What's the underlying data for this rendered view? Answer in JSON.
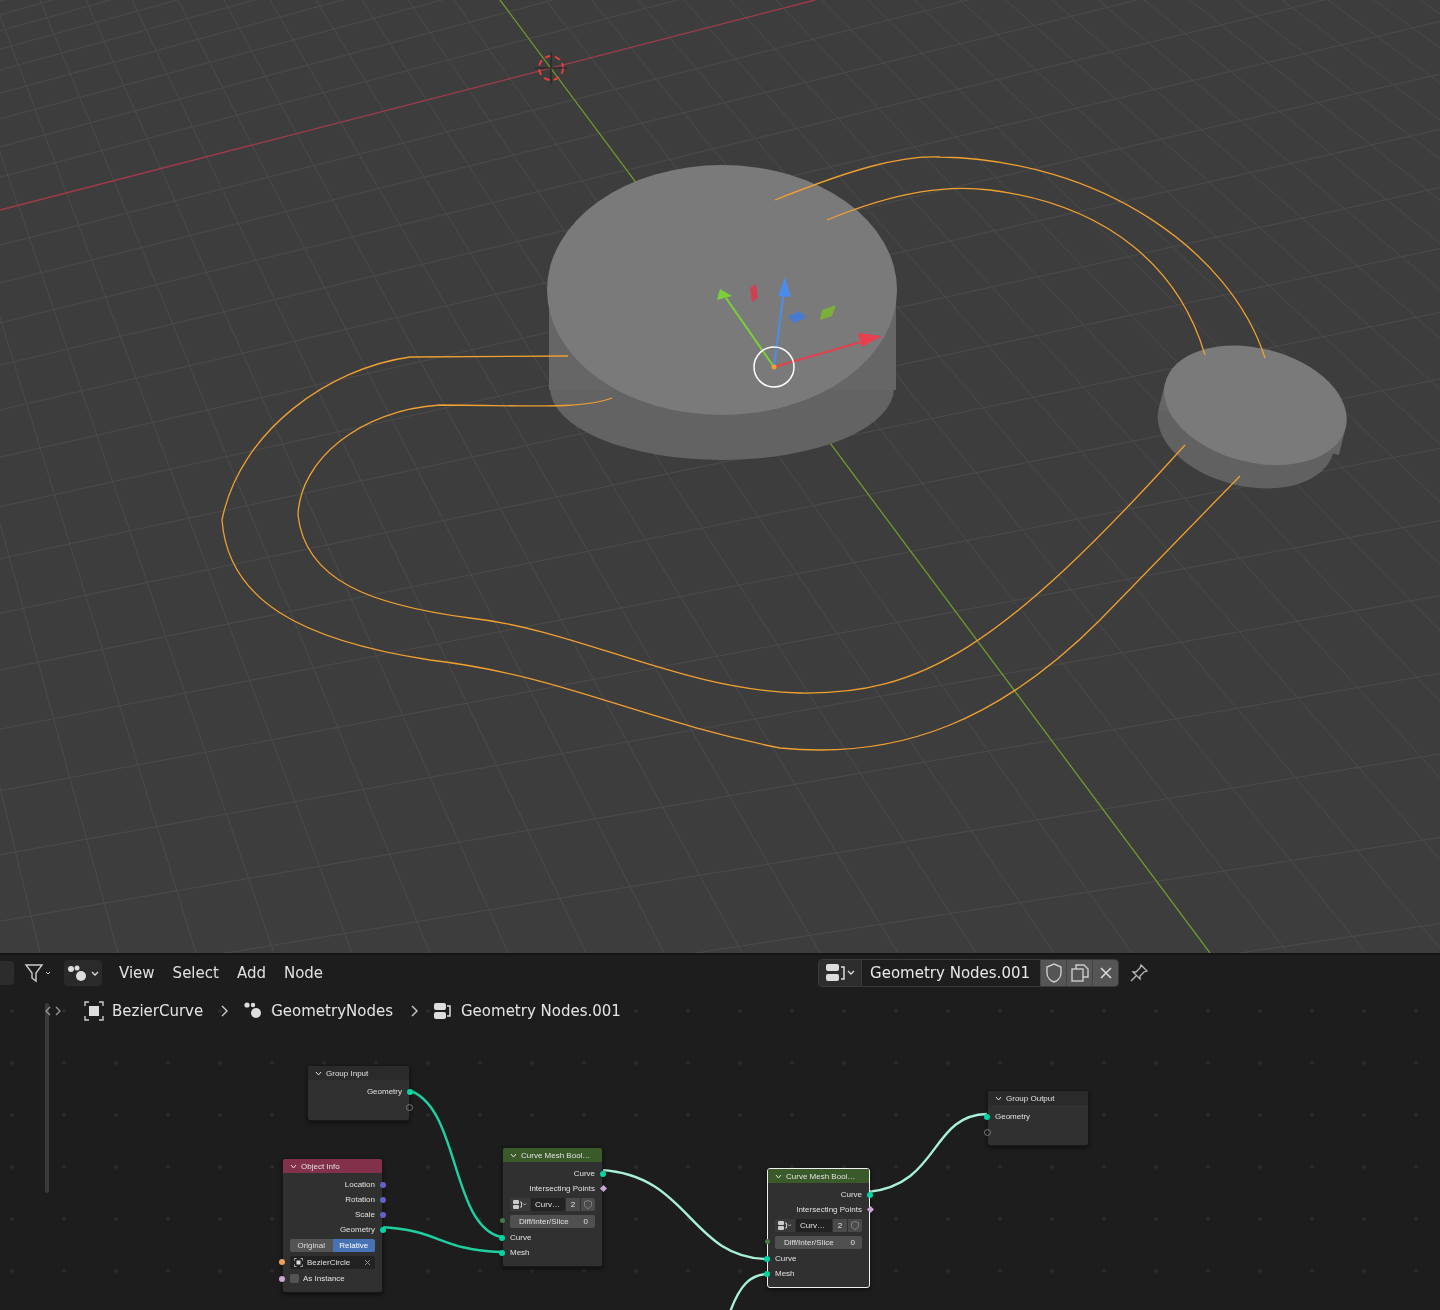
{
  "header": {
    "menus": [
      {
        "label": "View"
      },
      {
        "label": "Select"
      },
      {
        "label": "Add"
      },
      {
        "label": "Node"
      }
    ],
    "node_tree": {
      "name": "Geometry Nodes.001",
      "fake_user": false
    }
  },
  "breadcrumbs": [
    {
      "label": "BezierCurve",
      "kind": "object"
    },
    {
      "label": "GeometryNodes",
      "kind": "modifier"
    },
    {
      "label": "Geometry Nodes.001",
      "kind": "nodetree"
    }
  ],
  "nodes": [
    {
      "title": "Group Input",
      "color": "#2a2a2a",
      "selected": false,
      "rows": [
        {
          "kind": "output",
          "label": "Geometry",
          "color": "#00d6a3"
        },
        {
          "kind": "virtual_output"
        }
      ]
    },
    {
      "title": "Object Info",
      "color": "#83314a",
      "selected": false,
      "rows": [
        {
          "kind": "output",
          "label": "Location",
          "color": "#6363c7"
        },
        {
          "kind": "output",
          "label": "Rotation",
          "color": "#6363c7"
        },
        {
          "kind": "output",
          "label": "Scale",
          "color": "#6363c7"
        },
        {
          "kind": "output",
          "label": "Geometry",
          "color": "#00d6a3"
        },
        {
          "kind": "toggle",
          "options": [
            {
              "label": "Original",
              "selected": false
            },
            {
              "label": "Relative",
              "selected": true
            }
          ]
        },
        {
          "kind": "object_field",
          "value": "BezierCircle",
          "color": "#ed9e5c"
        },
        {
          "kind": "checkbox",
          "label": "As Instance",
          "checked": false,
          "color": "#cca6d6"
        }
      ]
    },
    {
      "title": "Curve Mesh Bool…",
      "color": "#3b5a2a",
      "selected": false,
      "rows": [
        {
          "kind": "output",
          "label": "Curve",
          "color": "#00d6a3"
        },
        {
          "kind": "field_output",
          "label": "Intersecting Points",
          "color": "#cca6d6"
        },
        {
          "kind": "datablock",
          "name": "Curv…",
          "users": "2"
        },
        {
          "kind": "enum",
          "label": "Diff/Inter/Slice",
          "value": "0",
          "color": "#4a7a4a"
        },
        {
          "kind": "input",
          "label": "Curve",
          "color": "#00d6a3"
        },
        {
          "kind": "input",
          "label": "Mesh",
          "color": "#00d6a3"
        }
      ]
    },
    {
      "title": "Curve Mesh Bool…",
      "color": "#3b5a2a",
      "selected": true,
      "rows": [
        {
          "kind": "output",
          "label": "Curve",
          "color": "#00d6a3"
        },
        {
          "kind": "field_output",
          "label": "Intersecting Points",
          "color": "#cca6d6"
        },
        {
          "kind": "datablock",
          "name": "Curv…",
          "users": "2"
        },
        {
          "kind": "enum",
          "label": "Diff/Inter/Slice",
          "value": "0",
          "color": "#4a7a4a"
        },
        {
          "kind": "input",
          "label": "Curve",
          "color": "#00d6a3"
        },
        {
          "kind": "input",
          "label": "Mesh",
          "color": "#00d6a3"
        }
      ]
    },
    {
      "title": "Group Output",
      "color": "#2a2a2a",
      "selected": false,
      "rows": [
        {
          "kind": "input",
          "label": "Geometry",
          "color": "#00d6a3"
        },
        {
          "kind": "virtual_input"
        }
      ]
    }
  ]
}
